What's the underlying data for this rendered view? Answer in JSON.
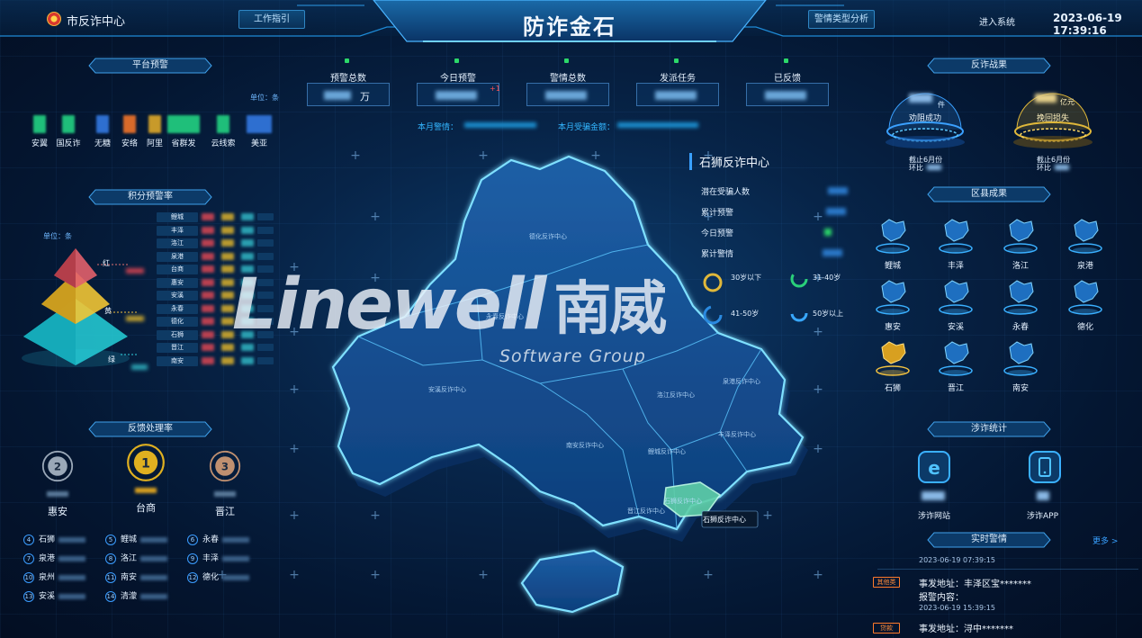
{
  "header": {
    "brand": "市反诈中心",
    "work_guide": "工作指引",
    "title": "防诈金石",
    "alert_type_analysis": "警情类型分析",
    "enter_system": "进入系统",
    "datetime": "2023-06-19 17:39:16"
  },
  "platform_alert": {
    "title": "平台预警",
    "unit": "单位：条",
    "items": [
      {
        "label": "安翼",
        "color": "#1fbf7a"
      },
      {
        "label": "国反诈",
        "color": "#1fbf7a"
      },
      {
        "label": "无糖",
        "color": "#2e6fd0"
      },
      {
        "label": "安络",
        "color": "#d86a2a"
      },
      {
        "label": "阿里",
        "color": "#c89a2a"
      },
      {
        "label": "省群发",
        "color": "#1fbf7a"
      },
      {
        "label": "云线索",
        "color": "#1fbf7a"
      },
      {
        "label": "美亚",
        "color": "#2e6fd0"
      }
    ]
  },
  "points_alert": {
    "title": "积分预警率",
    "unit": "单位：条",
    "tiers": [
      "红",
      "黄",
      "绿"
    ],
    "ranking": [
      "鲤城",
      "丰泽",
      "洛江",
      "泉港",
      "台商",
      "惠安",
      "安溪",
      "永春",
      "德化",
      "石狮",
      "晋江",
      "南安"
    ]
  },
  "feedback": {
    "title": "反馈处理率",
    "podium": [
      {
        "rank": "2",
        "name": "惠安"
      },
      {
        "rank": "1",
        "name": "台商"
      },
      {
        "rank": "3",
        "name": "晋江"
      }
    ],
    "list": [
      {
        "rank": "4",
        "name": "石狮"
      },
      {
        "rank": "5",
        "name": "鲤城"
      },
      {
        "rank": "6",
        "name": "永春"
      },
      {
        "rank": "7",
        "name": "泉港"
      },
      {
        "rank": "8",
        "name": "洛江"
      },
      {
        "rank": "9",
        "name": "丰泽"
      },
      {
        "rank": "10",
        "name": "泉州"
      },
      {
        "rank": "11",
        "name": "南安"
      },
      {
        "rank": "12",
        "name": "德化"
      },
      {
        "rank": "13",
        "name": "安溪"
      },
      {
        "rank": "14",
        "name": "清濛"
      }
    ]
  },
  "top_stats": [
    {
      "label": "预警总数",
      "unit": "万",
      "delta": ""
    },
    {
      "label": "今日预警",
      "unit": "",
      "delta": "+1"
    },
    {
      "label": "警情总数",
      "unit": "",
      "delta": ""
    },
    {
      "label": "发派任务",
      "unit": "",
      "delta": ""
    },
    {
      "label": "已反馈",
      "unit": "",
      "delta": ""
    }
  ],
  "month_alerts": "本月警情：",
  "month_loss": "本月受骗金额：",
  "stone_center": {
    "title": "石狮反诈中心",
    "rows": [
      "潜在受骗人数",
      "累计预警",
      "今日预警",
      "累计警情"
    ],
    "age_groups": [
      "30岁以下",
      "31-40岁",
      "41-50岁",
      "50岁以上"
    ]
  },
  "map": {
    "labels": [
      "德化反诈中心",
      "永春反诈中心",
      "安溪反诈中心",
      "洛江反诈中心",
      "泉港反诈中心",
      "鲤城反诈中心",
      "丰泽反诈中心",
      "南安反诈中心",
      "晋江反诈中心",
      "石狮反诈中心"
    ],
    "tooltip": "石狮反诈中心"
  },
  "results": {
    "title": "反诈战果",
    "left_unit": "件",
    "left_label": "劝阻成功",
    "left_note": "截止6月份",
    "left_ratio": "环比",
    "right_unit": "亿元",
    "right_label": "挽回损失",
    "right_note": "截止6月份",
    "right_ratio": "环比"
  },
  "district_results": {
    "title": "区县成果",
    "items": [
      "鲤城",
      "丰泽",
      "洛江",
      "泉港",
      "惠安",
      "安溪",
      "永春",
      "德化",
      "石狮",
      "晋江",
      "南安"
    ]
  },
  "fraud_stats": {
    "title": "涉诈统计",
    "web": "涉诈网站",
    "app": "涉诈APP"
  },
  "realtime": {
    "title": "实时警情",
    "more": "更多 >",
    "entries": [
      {
        "time_top": "2023-06-19 07:39:15",
        "tag": "其他类",
        "address": "事发地址：丰泽区宝*******",
        "content": "报警内容：",
        "time": "2023-06-19 15:39:15"
      },
      {
        "tag": "贷款",
        "address": "事发地址：浔中*******"
      }
    ]
  },
  "watermark": {
    "main": "Linewell",
    "cn": "南威",
    "sub": "Software Group"
  }
}
